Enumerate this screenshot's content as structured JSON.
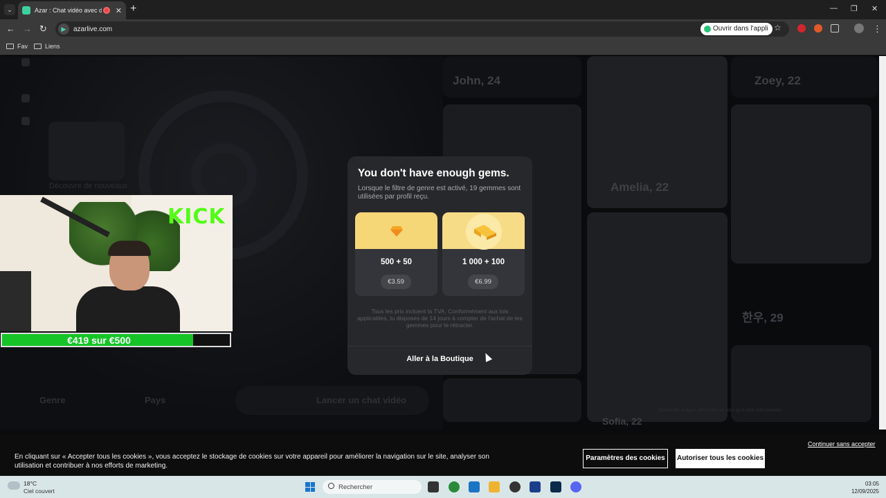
{
  "browser": {
    "tab_title": "Azar : Chat vidéo avec de n",
    "tab_close": "✕",
    "new_tab": "+",
    "url": "azarlive.com",
    "open_in_app": "Ouvrir dans l'appli",
    "bookmarks": [
      "Fav",
      "Liens"
    ],
    "window_controls": [
      "—",
      "❐",
      "✕"
    ]
  },
  "background": {
    "cards": [
      {
        "name": "John, 24"
      },
      {
        "name": "Zoey, 22"
      },
      {
        "name": "Amelia, 22"
      },
      {
        "name": "한우, 29"
      },
      {
        "name": "Sofia, 22"
      }
    ],
    "discover_text": "Découvre de nouveaux",
    "filters": {
      "gender": "Genre",
      "country": "Pays",
      "start": "Lancer un chat vidéo"
    },
    "note": "Toutes les images affichées ne sont qu'à titre d'illustration"
  },
  "modal": {
    "title": "You don't have enough gems.",
    "subtitle": "Lorsque le filtre de genre est activé, 19 gemmes sont utilisées par profil reçu.",
    "packs": [
      {
        "amount": "500 + 50",
        "price": "€3.59",
        "icon": "gem-icon"
      },
      {
        "amount": "1 000 + 100",
        "price": "€6.99",
        "icon": "gold-bars-icon"
      }
    ],
    "legal": "Tous les prix incluent la TVA. Conformément aux lois applicables, tu disposes de 14 jours à compter de l'achat de tes gemmes pour te rétracter.",
    "cta": "Aller à la Boutique"
  },
  "stream_overlay": {
    "brand": "KICK",
    "goal_text": "€419 sur €500",
    "goal_progress": 0.838
  },
  "cookie": {
    "text": "En cliquant sur « Accepter tous les cookies », vous acceptez le stockage de cookies sur votre appareil pour améliorer la navigation sur le site, analyser son utilisation et contribuer à nos efforts de marketing.",
    "skip": "Continuer sans accepter",
    "params": "Paramètres des cookies",
    "accept": "Autoriser tous les cookies"
  },
  "taskbar": {
    "weather_temp": "18°C",
    "weather_desc": "Ciel couvert",
    "search_placeholder": "Rechercher",
    "time": "03:05",
    "date": "12/09/2025"
  }
}
